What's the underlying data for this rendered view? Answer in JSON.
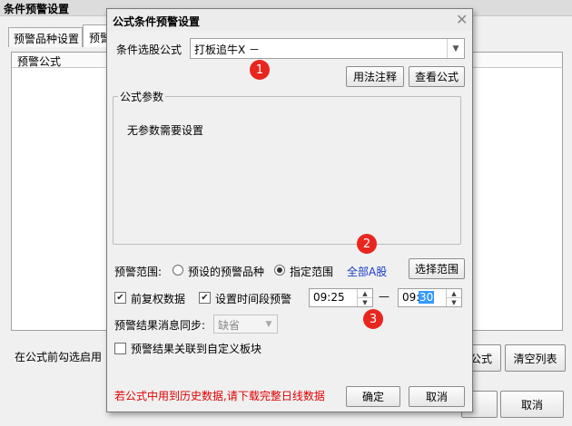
{
  "outer_window": {
    "title": "条件预警设置",
    "tabs": [
      "预警品种设置",
      "预警"
    ],
    "list_header": "预警公式",
    "hint": "在公式前勾选启用",
    "btn_formula_partial": "公式",
    "btn_clear_list": "清空列表",
    "btn_cancel": "取消"
  },
  "dialog": {
    "title": "公式条件预警设置",
    "close_icon": "close-icon",
    "formula_label": "条件选股公式",
    "formula_value": "打板追牛X  －",
    "btn_usage": "用法注释",
    "btn_view_formula": "查看公式",
    "params_group_title": "公式参数",
    "params_message": "无参数需要设置",
    "range_label": "预警范围:",
    "range_option_preset": "预设的预警品种",
    "range_option_specified": "指定范围",
    "range_value": "全部A股",
    "btn_select_range": "选择范围",
    "chk_prior_adjust": "前复权数据",
    "chk_time_segment": "设置时间段预警",
    "time_start": "09:25",
    "time_separator": "—",
    "time_end_hour": "09:",
    "time_end_minute": "30",
    "sync_label": "预警结果消息同步:",
    "sync_value": "缺省",
    "chk_link_block": "预警结果关联到自定义板块",
    "warning": "若公式中用到历史数据,请下载完整日线数据",
    "btn_ok": "确定",
    "btn_cancel": "取消"
  },
  "annotations": [
    "1",
    "2",
    "3"
  ],
  "colors": {
    "warning_text": "#e00000",
    "link_blue": "#1a3cc8",
    "badge_red": "#e8261f",
    "selection": "#3399ff"
  }
}
